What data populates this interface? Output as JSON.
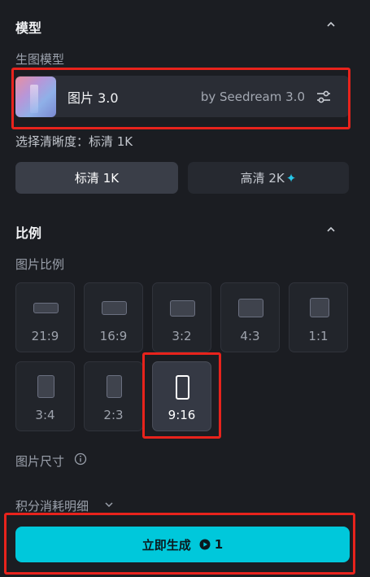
{
  "model_section": {
    "title": "模型",
    "sub_label": "生图模型"
  },
  "model_card": {
    "name": "图片 3.0",
    "by": "by Seedream 3.0"
  },
  "resolution": {
    "label": "选择清晰度：标清 1K",
    "options": [
      "标清 1K",
      "高清 2K"
    ],
    "selected": "标清 1K"
  },
  "ratio_section": {
    "title": "比例",
    "sub_label": "图片比例"
  },
  "ratios": [
    "21:9",
    "16:9",
    "3:2",
    "4:3",
    "1:1",
    "3:4",
    "2:3",
    "9:16"
  ],
  "ratio_selected": "9:16",
  "size_label": "图片尺寸",
  "credits_label": "积分消耗明细",
  "generate": {
    "label": "立即生成",
    "cost": "1"
  },
  "colors": {
    "accent": "#00c8db",
    "highlight": "#e8231c",
    "background": "#1b1d22"
  }
}
